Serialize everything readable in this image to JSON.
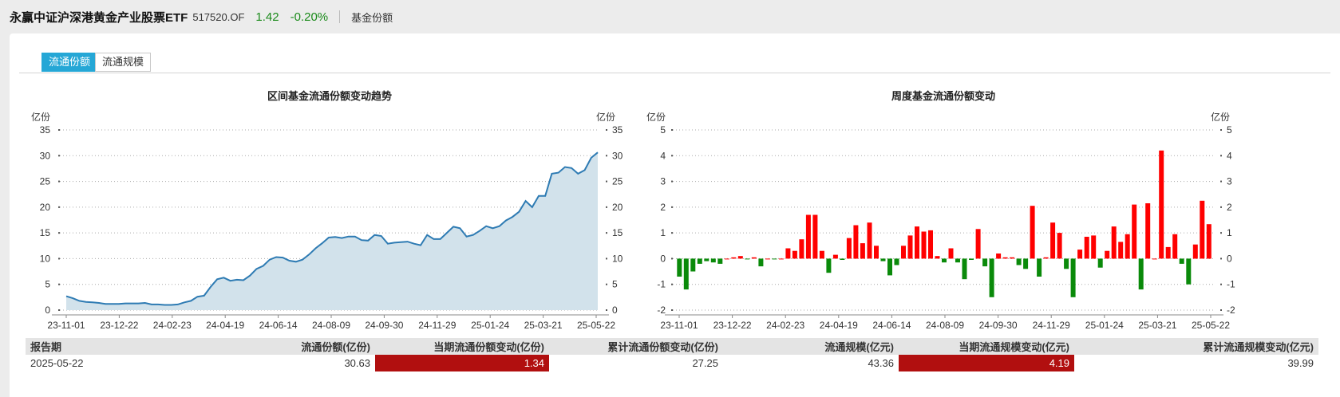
{
  "header": {
    "fund_name": "永赢中证沪深港黄金产业股票ETF",
    "fund_code": "517520.OF",
    "price": "1.42",
    "change": "-0.20%",
    "tab": "基金份额",
    "up_color": "#ff0000",
    "down_color": "#1a8a1a"
  },
  "tabs": [
    "流通份额",
    "流通规模"
  ],
  "chart_data": [
    {
      "type": "area",
      "title": "区间基金流通份额变动趋势",
      "unit": "亿份",
      "ylim": [
        0,
        35
      ],
      "yticks": [
        0,
        5,
        10,
        15,
        20,
        25,
        30,
        35
      ],
      "xticks": [
        "23-11-01",
        "23-12-22",
        "24-02-23",
        "24-04-19",
        "24-06-14",
        "24-08-09",
        "24-09-30",
        "24-11-29",
        "25-01-24",
        "25-03-21",
        "25-05-22"
      ],
      "grid": true,
      "color": "#2e7bb3",
      "fill": "#d2e2eb",
      "values": [
        2.7,
        2.3,
        1.8,
        1.6,
        1.5,
        1.4,
        1.2,
        1.2,
        1.2,
        1.3,
        1.3,
        1.3,
        1.4,
        1.1,
        1.1,
        1.0,
        1.0,
        1.1,
        1.5,
        1.8,
        2.6,
        2.8,
        4.5,
        6.0,
        6.3,
        5.7,
        5.9,
        5.8,
        6.7,
        8.0,
        8.6,
        9.8,
        10.3,
        10.2,
        9.6,
        9.4,
        9.8,
        10.8,
        12.0,
        13.0,
        14.1,
        14.2,
        14.0,
        14.3,
        14.3,
        13.6,
        13.5,
        14.6,
        14.4,
        12.9,
        13.1,
        13.2,
        13.3,
        12.9,
        12.6,
        14.6,
        13.8,
        13.8,
        15.0,
        16.2,
        15.9,
        14.3,
        14.6,
        15.4,
        16.3,
        15.9,
        16.3,
        17.4,
        18.1,
        19.1,
        21.2,
        20.0,
        22.2,
        22.2,
        26.5,
        26.7,
        27.8,
        27.6,
        26.5,
        27.2,
        29.6,
        30.63
      ]
    },
    {
      "type": "bar",
      "title": "周度基金流通份额变动",
      "unit": "亿份",
      "ylim": [
        -2,
        5
      ],
      "yticks": [
        -2,
        -1,
        0,
        1,
        2,
        3,
        4,
        5
      ],
      "xticks": [
        "23-11-01",
        "23-12-22",
        "24-02-23",
        "24-04-19",
        "24-06-14",
        "24-08-09",
        "24-09-30",
        "24-11-29",
        "25-01-24",
        "25-03-21",
        "25-05-22"
      ],
      "grid": true,
      "positive_color": "#ff0000",
      "negative_color": "#0a8a0a",
      "values": [
        -0.7,
        -1.2,
        -0.5,
        -0.2,
        -0.1,
        -0.15,
        -0.2,
        0.0,
        0.05,
        0.1,
        -0.02,
        0.05,
        -0.3,
        0.0,
        -0.02,
        0.0,
        0.4,
        0.3,
        0.75,
        1.7,
        1.7,
        0.3,
        -0.55,
        0.15,
        -0.05,
        0.8,
        1.3,
        0.6,
        1.4,
        0.5,
        -0.1,
        -0.65,
        -0.25,
        0.5,
        0.9,
        1.25,
        1.05,
        1.1,
        0.1,
        -0.15,
        0.4,
        -0.15,
        -0.8,
        -0.05,
        1.15,
        -0.3,
        -1.5,
        0.2,
        0.05,
        0.05,
        -0.25,
        -0.4,
        2.05,
        -0.7,
        0.05,
        1.4,
        1.0,
        -0.4,
        -1.5,
        0.35,
        0.85,
        0.9,
        -0.35,
        0.3,
        1.25,
        0.65,
        0.95,
        2.1,
        -1.2,
        2.15,
        0.0,
        4.2,
        0.45,
        0.95,
        -0.2,
        -1.0,
        0.55,
        2.25,
        1.34
      ]
    }
  ],
  "table": {
    "headers": [
      "报告期",
      "流通份额(亿份)",
      "当期流通份额变动(亿份)",
      "累计流通份额变动(亿份)",
      "流通规模(亿元)",
      "当期流通规模变动(亿元)",
      "累计流通规模变动(亿元)"
    ],
    "rows": [
      [
        "2025-05-22",
        "30.63",
        "1.34",
        "27.25",
        "43.36",
        "4.19",
        "39.99"
      ]
    ],
    "highlight_color": "#b10f0f"
  }
}
